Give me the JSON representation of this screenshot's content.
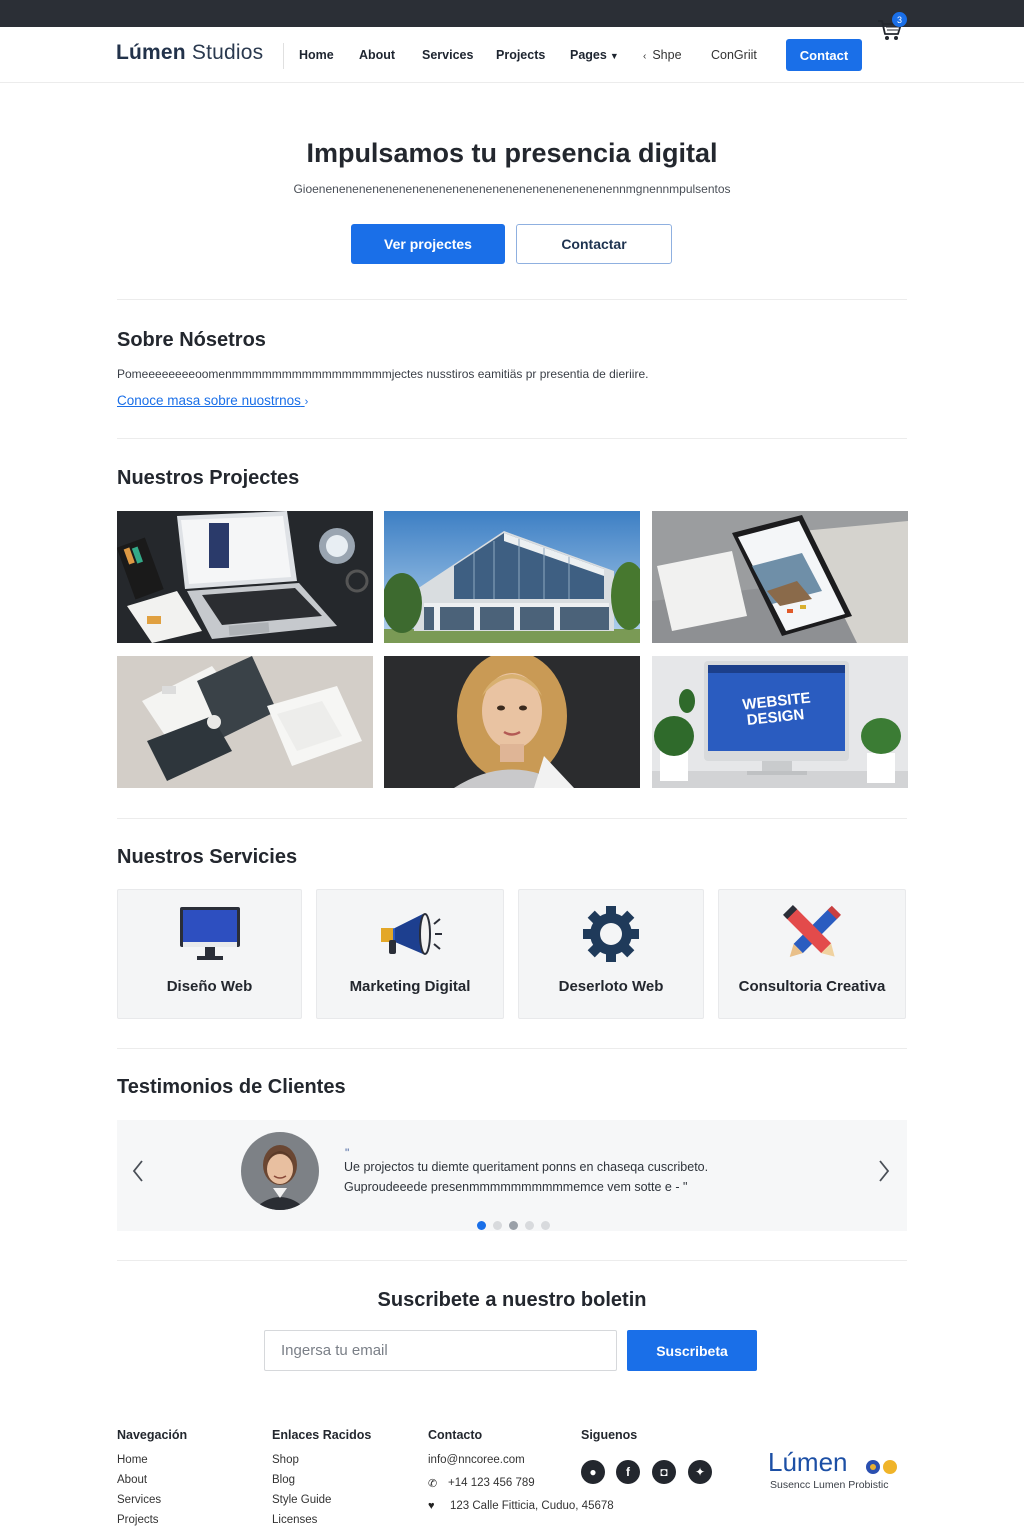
{
  "header": {
    "logo_bold": "Lúmen",
    "logo_light": " Studios",
    "nav": [
      "Home",
      "About",
      "Services",
      "Projects",
      "Pages"
    ],
    "shop": "Shpe",
    "extra": "ConGriit",
    "contact": "Contact",
    "cart_count": "3"
  },
  "hero": {
    "title": "Impulsamos tu presencia digital",
    "subtitle": "Gioenenenenenenenenenenenenenenenenenenenenenenennmgnennmpulsentos",
    "primary_button": "Ver projectes",
    "secondary_button": "Contactar"
  },
  "about": {
    "title": "Sobre Nósetros",
    "text": "Pomeeeeeeeeoomenmmmmmmmmmmmmmmmmjectes nusstiros eamitiäs pr presentia de dieriire.",
    "link": "Conoce masa sobre nuostrnos",
    "link_chevron": "›"
  },
  "projects": {
    "title": "Nuestros Projectes"
  },
  "services": {
    "title": "Nuestros Servicies",
    "items": [
      {
        "label": "Diseño Web",
        "icon": "monitor-icon"
      },
      {
        "label": "Marketing Digital",
        "icon": "megaphone-icon"
      },
      {
        "label": "Deserloto Web",
        "icon": "gear-icon"
      },
      {
        "label": "Consultoria Creativa",
        "icon": "pencil-tools-icon"
      }
    ]
  },
  "testimonials": {
    "title": "Testimonios de Clientes",
    "quote_open": "\"",
    "line1": "Ue projectos tu diemte queritament ponns en chaseqa cuscribeto.",
    "line2": "Guproudeeede presenmmmmmmmmmmemce vem sotte e - \"",
    "active_dot": 0,
    "dot_count": 5
  },
  "newsletter": {
    "title": "Suscribete a nuestro boletin",
    "placeholder": "Ingersa tu email",
    "button": "Suscribeta"
  },
  "footer": {
    "col1_title": "Navegación",
    "col1_links": [
      "Home",
      "About",
      "Services",
      "Projects"
    ],
    "col2_title": "Enlaces Racidos",
    "col2_links": [
      "Shop",
      "Blog",
      "Style Guide",
      "Licenses"
    ],
    "col3_title": "Contacto",
    "email": "info@nncoree.com",
    "phone": "+14 123 456 789",
    "address": "123 Calle Fitticia, Cuduo, 45678",
    "col4_title": "Siguenos",
    "logo": "Lúmen",
    "tagline": "Susencc Lumen Probistic"
  },
  "colors": {
    "accent": "#1a6fe8",
    "dark": "#23272e",
    "topbar": "#2b2f36"
  }
}
